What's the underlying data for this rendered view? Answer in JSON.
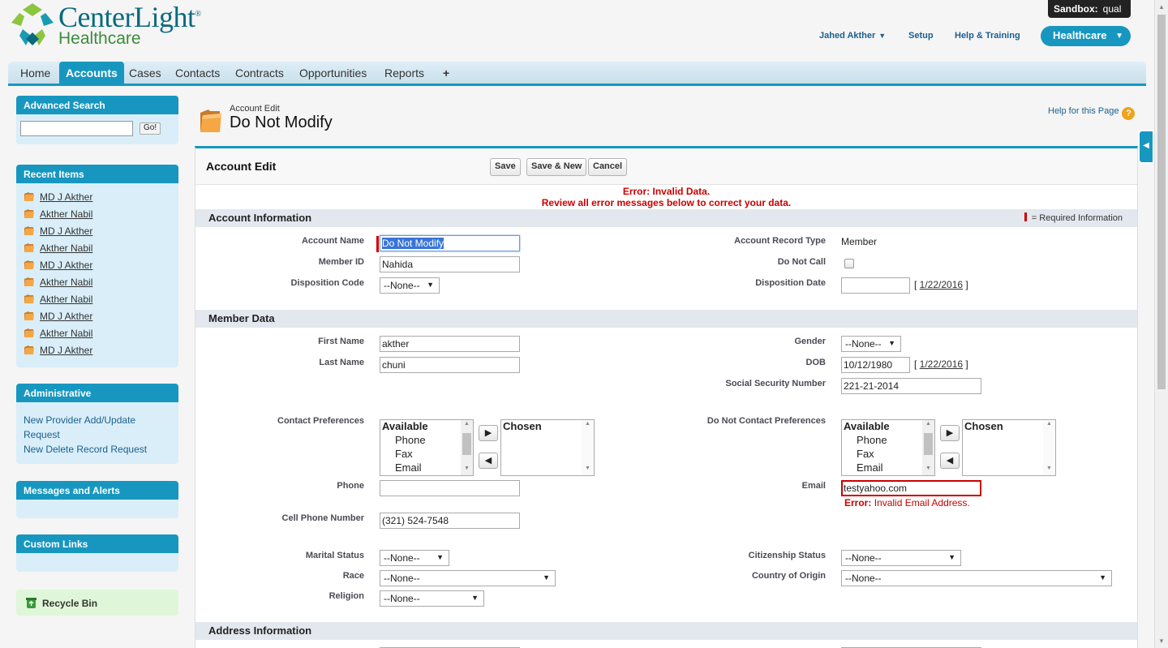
{
  "header": {
    "logo_line1": "CenterLight",
    "logo_reg": "®",
    "logo_line2": "Healthcare",
    "sandbox_label": "Sandbox:",
    "sandbox_value": "qual",
    "user_menu": "Jahed Akther",
    "setup": "Setup",
    "help_training": "Help & Training",
    "app_menu": "Healthcare",
    "colors": {
      "accent": "#1797c0",
      "logo_teal": "#0a6a7e",
      "logo_green": "#3c8c3c"
    }
  },
  "tabs": [
    {
      "label": "Home",
      "active": false
    },
    {
      "label": "Accounts",
      "active": true
    },
    {
      "label": "Cases",
      "active": false
    },
    {
      "label": "Contacts",
      "active": false
    },
    {
      "label": "Contracts",
      "active": false
    },
    {
      "label": "Opportunities",
      "active": false
    },
    {
      "label": "Reports",
      "active": false
    },
    {
      "label": "+",
      "active": false
    }
  ],
  "sidebar": {
    "advanced_search": {
      "title": "Advanced Search",
      "go": "Go!",
      "value": ""
    },
    "recent_items": {
      "title": "Recent Items",
      "items": [
        "MD J Akther",
        "Akther Nabil",
        "MD J Akther",
        "Akther Nabil",
        "MD J Akther",
        "Akther Nabil",
        "Akther Nabil",
        "MD J Akther",
        "Akther Nabil",
        "MD J Akther"
      ]
    },
    "administrative": {
      "title": "Administrative",
      "links": [
        "New Provider Add/Update Request",
        "New Delete Record Request"
      ]
    },
    "messages": {
      "title": "Messages and Alerts"
    },
    "custom_links": {
      "title": "Custom Links"
    },
    "recycle_bin": "Recycle Bin"
  },
  "page": {
    "breadcrumb": "Account Edit",
    "title": "Do Not Modify",
    "help": "Help for this Page",
    "help_icon": "?"
  },
  "form": {
    "title": "Account Edit",
    "buttons": {
      "save": "Save",
      "save_new": "Save & New",
      "cancel": "Cancel"
    },
    "error_line1": "Error: Invalid Data.",
    "error_line2": "Review all error messages below to correct your data.",
    "required_legend": "= Required Information",
    "sections": {
      "account_info": "Account Information",
      "member_data": "Member Data",
      "address_info": "Address Information"
    },
    "fields": {
      "account_name": {
        "label": "Account Name",
        "value": "Do Not Modify"
      },
      "member_id": {
        "label": "Member ID",
        "value": "Nahida"
      },
      "disposition_code": {
        "label": "Disposition Code",
        "value": "--None--"
      },
      "account_record_type": {
        "label": "Account Record Type",
        "value": "Member"
      },
      "do_not_call": {
        "label": "Do Not Call",
        "checked": false
      },
      "disposition_date": {
        "label": "Disposition Date",
        "value": "",
        "today_link": "1/22/2016"
      },
      "first_name": {
        "label": "First Name",
        "value": "akther"
      },
      "last_name": {
        "label": "Last Name",
        "value": "chuni"
      },
      "gender": {
        "label": "Gender",
        "value": "--None--"
      },
      "dob": {
        "label": "DOB",
        "value": "10/12/1980",
        "today_link": "1/22/2016"
      },
      "ssn": {
        "label": "Social Security Number",
        "value": "221-21-2014"
      },
      "contact_prefs": {
        "label": "Contact Preferences",
        "available_header": "Available",
        "available": [
          "Phone",
          "Fax",
          "Email"
        ],
        "chosen_header": "Chosen"
      },
      "do_not_contact_prefs": {
        "label": "Do Not Contact Preferences",
        "available_header": "Available",
        "available": [
          "Phone",
          "Fax",
          "Email"
        ],
        "chosen_header": "Chosen"
      },
      "phone": {
        "label": "Phone",
        "value": ""
      },
      "email": {
        "label": "Email",
        "value": "testyahoo.com",
        "error_prefix": "Error:",
        "error": "Invalid Email Address."
      },
      "cell_phone": {
        "label": "Cell Phone Number",
        "value": "(321) 524-7548"
      },
      "marital_status": {
        "label": "Marital Status",
        "value": "--None--"
      },
      "citizenship_status": {
        "label": "Citizenship Status",
        "value": "--None--"
      },
      "race": {
        "label": "Race",
        "value": "--None--"
      },
      "country_of_origin": {
        "label": "Country of Origin",
        "value": "--None--"
      },
      "religion": {
        "label": "Religion",
        "value": "--None--"
      }
    }
  }
}
